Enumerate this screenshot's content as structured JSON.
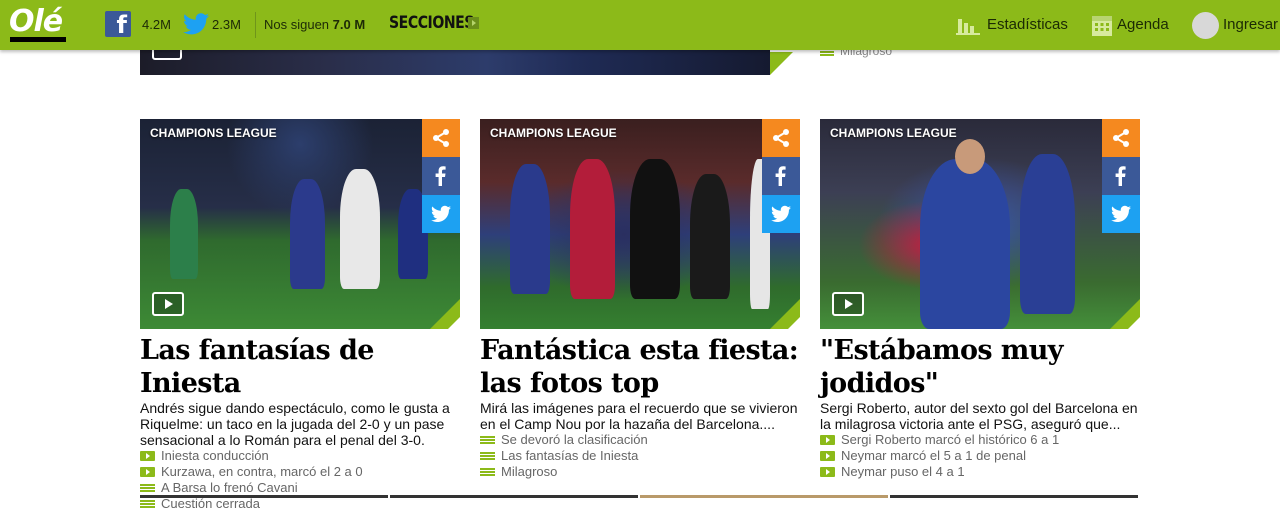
{
  "header": {
    "logo_text": "Olé",
    "facebook_count": "4.2M",
    "twitter_count": "2.3M",
    "follow_label": "Nos siguen",
    "follow_count": "7.0 M",
    "sections_label": "SECCIONES",
    "stats_label": "Estadísticas",
    "agenda_label": "Agenda",
    "login_label": "Ingresar",
    "brand_color": "#8cba19"
  },
  "previous_row": {
    "related_last": "Milagroso"
  },
  "cards": [
    {
      "tag": "CHAMPIONS LEAGUE",
      "headline": "Las fantasías de Iniesta",
      "summary": "Andrés sigue dando espectáculo, como le gusta a Riquelme: un taco en la jugada del 2-0 y un pase sensacional a lo Román para el penal del 3-0.",
      "related": [
        {
          "icon": "play-icon",
          "text": "Iniesta conducción"
        },
        {
          "icon": "play-icon",
          "text": "Kurzawa, en contra, marcó el 2 a 0"
        },
        {
          "icon": "list-icon",
          "text": "A Barsa lo frenó Cavani"
        },
        {
          "icon": "list-icon",
          "text": "Cuestión cerrada"
        }
      ]
    },
    {
      "tag": "CHAMPIONS LEAGUE",
      "headline": "Fantástica esta fiesta: las fotos top",
      "summary": "Mirá las imágenes para el recuerdo que se vivieron en el Camp Nou por la hazaña del Barcelona....",
      "related": [
        {
          "icon": "list-icon",
          "text": "Se devoró la clasificación"
        },
        {
          "icon": "list-icon",
          "text": "Las fantasías de Iniesta"
        },
        {
          "icon": "list-icon",
          "text": "Milagroso"
        }
      ]
    },
    {
      "tag": "CHAMPIONS LEAGUE",
      "headline": "\"Estábamos muy jodidos\"",
      "summary": "Sergi Roberto, autor del sexto gol del Barcelona en la milagrosa victoria ante el PSG, aseguró que...",
      "related": [
        {
          "icon": "play-icon",
          "text": "Sergi Roberto marcó el histórico 6 a 1"
        },
        {
          "icon": "play-icon",
          "text": "Neymar marcó el 5 a 1 de penal"
        },
        {
          "icon": "play-icon",
          "text": "Neymar puso el 4 a 1"
        }
      ]
    }
  ]
}
